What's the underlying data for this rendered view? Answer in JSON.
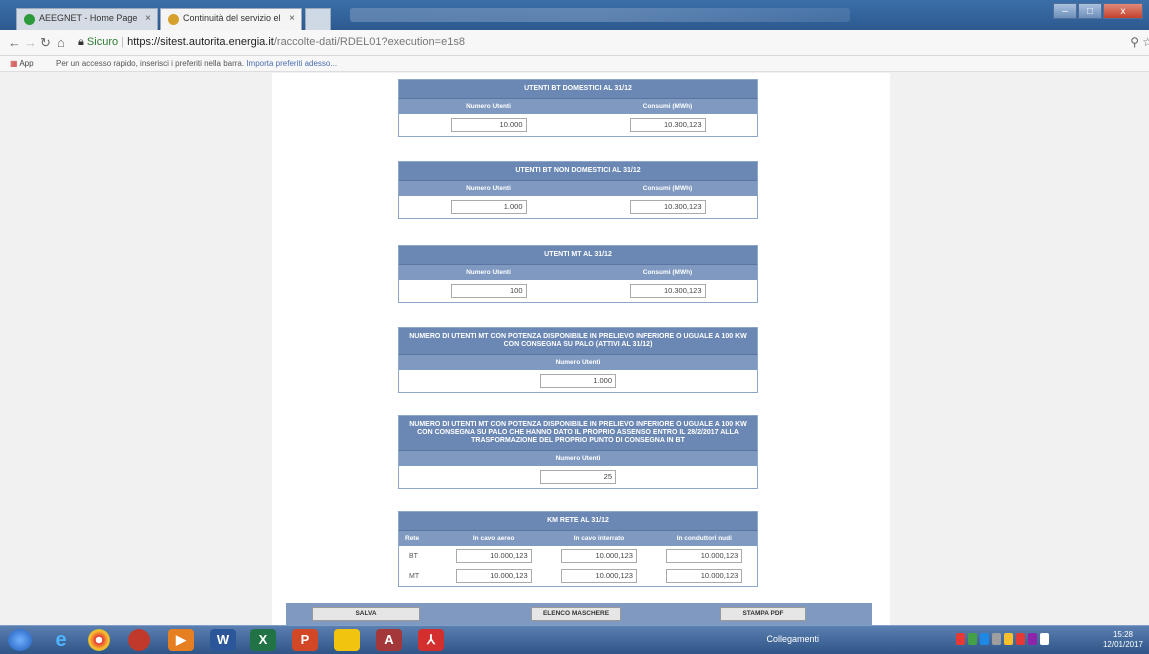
{
  "browser": {
    "tabs": [
      {
        "label": "AEEGNET - Home Page",
        "close": "×"
      },
      {
        "label": "Continuità del servizio el",
        "close": "×"
      }
    ],
    "window_buttons": [
      "–",
      "□",
      "x"
    ],
    "url": {
      "secure_label": "Sicuro",
      "host": "https://sitest.autorita.energia.it",
      "path": "/raccolte-dati/RDEL01?execution=e1s8"
    },
    "bookmarks": {
      "apps_label": "App",
      "hint": "Per un accesso rapido, inserisci i preferiti nella barra.",
      "import_link": "Importa preferiti adesso..."
    }
  },
  "sections": {
    "bt_dom": {
      "title": "UTENTI BT DOMESTICI AL 31/12",
      "col1": "Numero Utenti",
      "col2": "Consumi (MWh)",
      "val1": "10.000",
      "val2": "10.300,123"
    },
    "bt_nondom": {
      "title": "UTENTI BT NON DOMESTICI AL 31/12",
      "col1": "Numero Utenti",
      "col2": "Consumi (MWh)",
      "val1": "1.000",
      "val2": "10.300,123"
    },
    "mt": {
      "title": "UTENTI MT AL 31/12",
      "col1": "Numero Utenti",
      "col2": "Consumi (MWh)",
      "val1": "100",
      "val2": "10.300,123"
    },
    "mt_palo": {
      "title": "NUMERO DI UTENTI MT CON POTENZA DISPONIBILE IN PRELIEVO INFERIORE O UGUALE A 100 KW CON CONSEGNA SU PALO (ATTIVI AL 31/12)",
      "col1": "Numero Utenti",
      "val1": "1.000"
    },
    "mt_assenso": {
      "title": "NUMERO DI UTENTI MT CON POTENZA DISPONIBILE IN PRELIEVO INFERIORE O UGUALE A 100 KW CON CONSEGNA SU PALO CHE HANNO DATO IL PROPRIO ASSENSO ENTRO IL 28/2/2017 ALLA TRASFORMAZIONE DEL PROPRIO PUNTO DI CONSEGNA IN BT",
      "col1": "Numero Utenti",
      "val1": "25"
    },
    "km_rete": {
      "title": "KM RETE AL 31/12",
      "cols": [
        "Rete",
        "In cavo aereo",
        "In cavo interrato",
        "In conduttori nudi"
      ],
      "rows": [
        {
          "rete": "BT",
          "v1": "10.000,123",
          "v2": "10.000,123",
          "v3": "10.000,123"
        },
        {
          "rete": "MT",
          "v1": "10.000,123",
          "v2": "10.000,123",
          "v3": "10.000,123"
        }
      ]
    }
  },
  "buttons": {
    "salva": "SALVA",
    "elenco": "ELENCO MASCHERE",
    "stampa": "STAMPA PDF"
  },
  "taskbar": {
    "tray_label": "Collegamenti",
    "time": "15:28",
    "date": "12/01/2017"
  }
}
